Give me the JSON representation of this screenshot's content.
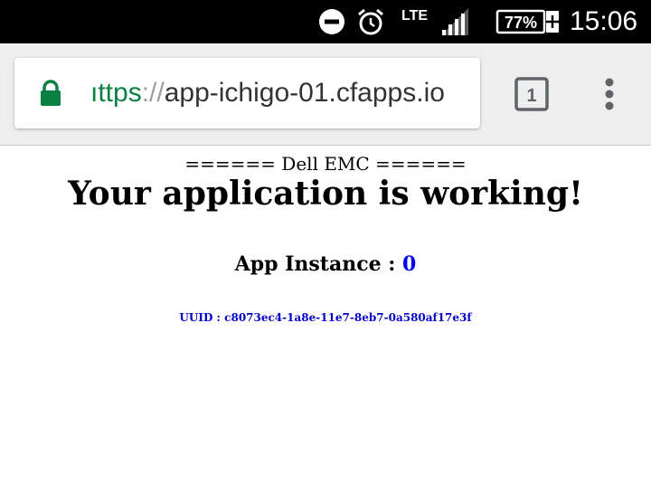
{
  "status_bar": {
    "icons": [
      "do-not-disturb-icon",
      "alarm-icon",
      "signal-icon",
      "battery-icon"
    ],
    "network": "LTE",
    "battery_level": "77%",
    "time": "15:06"
  },
  "browser": {
    "url_scheme_visible": "ıttps",
    "url_separator": "://",
    "url_host": "app-ichigo-01.cfapps.io",
    "tab_count": "1",
    "icons": [
      "lock-icon",
      "tab-switcher-icon",
      "overflow-menu-icon"
    ]
  },
  "page": {
    "header_line": "====== Dell EMC ======",
    "headline": "Your application is working!",
    "instance_label": "App Instance : ",
    "instance_value": "0",
    "uuid": "UUID : c8073ec4-1a8e-11e7-8eb7-0a580af17e3f"
  },
  "colors": {
    "status_bar": "#000000",
    "toolbar": "#eeeeee",
    "secure_green": "#0b8043",
    "link_blue": "#0000ee"
  }
}
